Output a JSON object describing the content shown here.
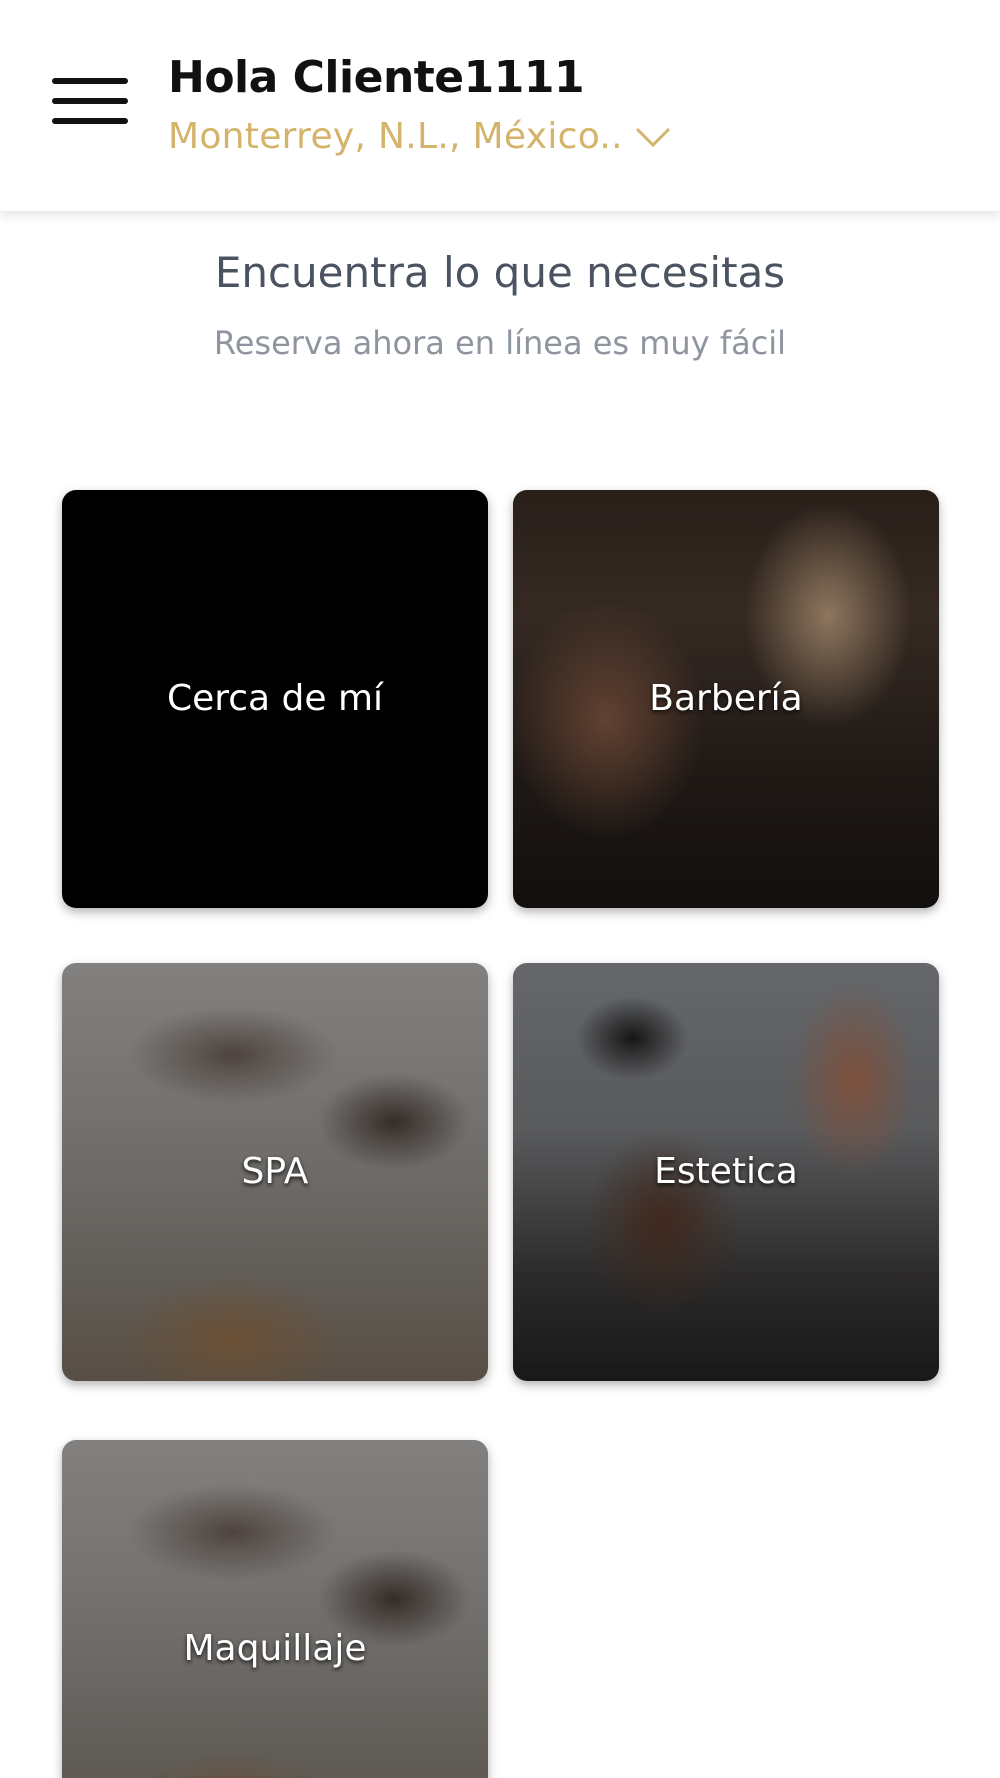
{
  "header": {
    "greeting": "Hola Cliente1111",
    "location": "Monterrey, N.L., México..",
    "location_color": "#d4b36a"
  },
  "intro": {
    "title": "Encuentra lo que necesitas",
    "subtitle": "Reserva ahora en línea es muy fácil"
  },
  "categories": [
    {
      "label": "Cerca de mí"
    },
    {
      "label": "Barbería"
    },
    {
      "label": "SPA"
    },
    {
      "label": "Estetica"
    },
    {
      "label": "Maquillaje"
    }
  ]
}
